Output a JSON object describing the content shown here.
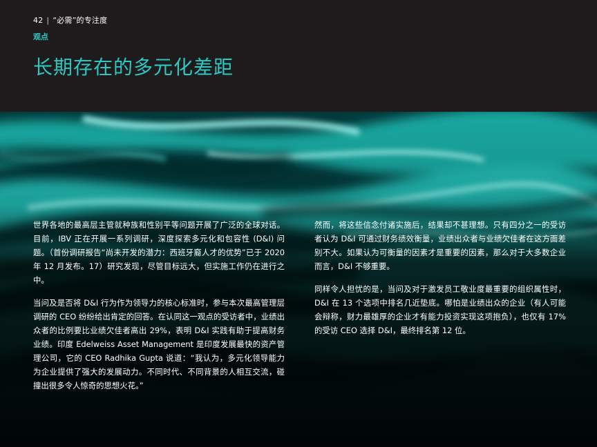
{
  "header": {
    "page_number": "42",
    "separator": "|",
    "publication_title": "“必需”的专注度",
    "section_label": "观点",
    "title": "长期存在的多元化差距"
  },
  "body": {
    "left_paragraphs": [
      "世界各地的最高层主管就种族和性别平等问题开展了广泛的全球对话。目前，IBV 正在开展一系列调研，深度探索多元化和包容性 (D&I) 问题。（首份调研报告“尚未开发的潜力：西班牙裔人才的优势”已于 2020 年 12 月发布。17）研究发现，尽管目标远大，但实施工作仍在进行之中。",
      "当问及是否将 D&I 行为作为领导力的核心标准时，参与本次最高管理层调研的 CEO 纷纷给出肯定的回答。在认同这一观点的受访者中，业绩出众者的比例要比业绩欠佳者高出 29%，表明 D&I 实践有助于提高财务业绩。印度 Edelweiss Asset Management 是印度发展最快的资产管理公司，它的 CEO Radhika Gupta 说道：“我认为，多元化领导能力为企业提供了强大的发展动力。不同时代、不同背景的人相互交流，碰撞出很多令人惊奇的思想火花。”"
    ],
    "right_paragraphs": [
      "然而，将这些信念付诸实施后，结果却不甚理想。只有四分之一的受访者认为 D&I 可通过财务绩效衡量，业绩出众者与业绩欠佳者在这方面差别不大。如果认为可衡量的因素才是重要的因素，那么对于大多数企业而言，D&I 不够重要。",
      "同样令人担忧的是，当问及对于激发员工敬业度最重要的组织属性时，D&I 在 13 个选项中排名几近垫底。哪怕是业绩出众的企业（有人可能会辩称，财力最雄厚的企业才有能力投资实现这项抱负），也仅有 17% 的受访 CEO 选择 D&I，最终排名第 12 位。"
    ]
  },
  "colors": {
    "accent": "#2ec7c1",
    "background": "#1d1b1c",
    "text": "#ffffff"
  }
}
